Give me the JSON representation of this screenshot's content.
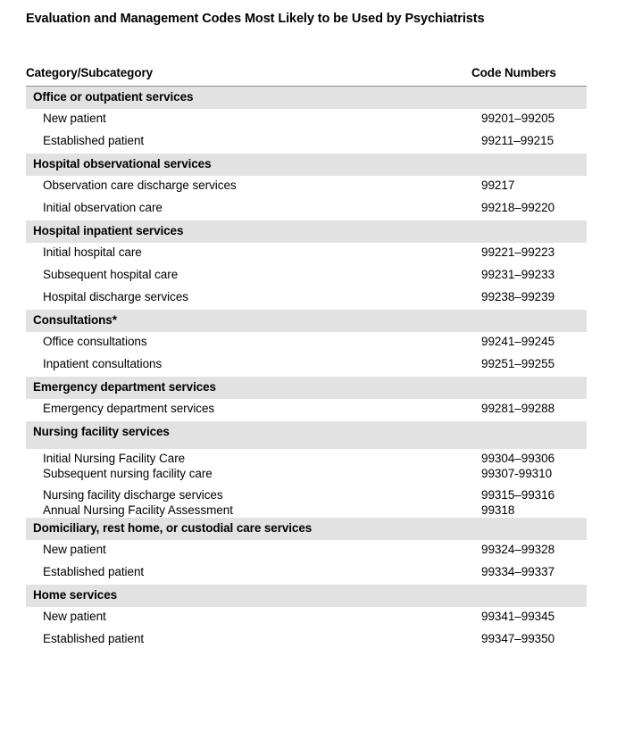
{
  "document": {
    "title": "Evaluation and Management Codes Most Likely to be Used by Psychiatrists"
  },
  "table": {
    "headers": {
      "category": "Category/Subcategory",
      "code": "Code Numbers"
    },
    "sections": [
      {
        "category": "Office or outpatient services",
        "rows": [
          {
            "label": "New patient",
            "code": "99201–99205"
          },
          {
            "label": "Established patient",
            "code": "99211–99215"
          }
        ]
      },
      {
        "category": "Hospital observational services",
        "rows": [
          {
            "label": "Observation care discharge services",
            "code": "99217"
          },
          {
            "label": "Initial observation care",
            "code": "99218–99220"
          }
        ]
      },
      {
        "category": "Hospital inpatient services",
        "rows": [
          {
            "label": "Initial hospital care",
            "code": "99221–99223"
          },
          {
            "label": "Subsequent hospital care",
            "code": "99231–99233"
          },
          {
            "label": "Hospital discharge services",
            "code": "99238–99239"
          }
        ]
      },
      {
        "category": "Consultations*",
        "rows": [
          {
            "label": "Office consultations",
            "code": "99241–99245"
          },
          {
            "label": "Inpatient consultations",
            "code": "99251–99255"
          }
        ]
      },
      {
        "category": "Emergency department services",
        "rows": [
          {
            "label": "Emergency department services",
            "code": "99281–99288"
          }
        ]
      },
      {
        "category": "Nursing facility services",
        "rows": [
          {
            "label": "Initial Nursing Facility Care",
            "code": "99304–99306"
          },
          {
            "label": "Subsequent nursing facility care",
            "code": "99307-99310"
          },
          {
            "label": "Nursing facility discharge services",
            "code": "99315–99316"
          },
          {
            "label": "Annual Nursing Facility Assessment",
            "code": "99318"
          }
        ]
      },
      {
        "category": "Domiciliary, rest home, or custodial care services",
        "rows": [
          {
            "label": "New patient",
            "code": "99324–99328"
          },
          {
            "label": "Established patient",
            "code": "99334–99337"
          }
        ]
      },
      {
        "category": "Home services",
        "rows": [
          {
            "label": "New patient",
            "code": "99341–99345"
          },
          {
            "label": "Established patient",
            "code": "99347–99350"
          }
        ]
      }
    ]
  },
  "colors": {
    "band": "#e2e2e2",
    "rule": "#8d8d8d",
    "text": "#000000",
    "background": "#ffffff"
  }
}
